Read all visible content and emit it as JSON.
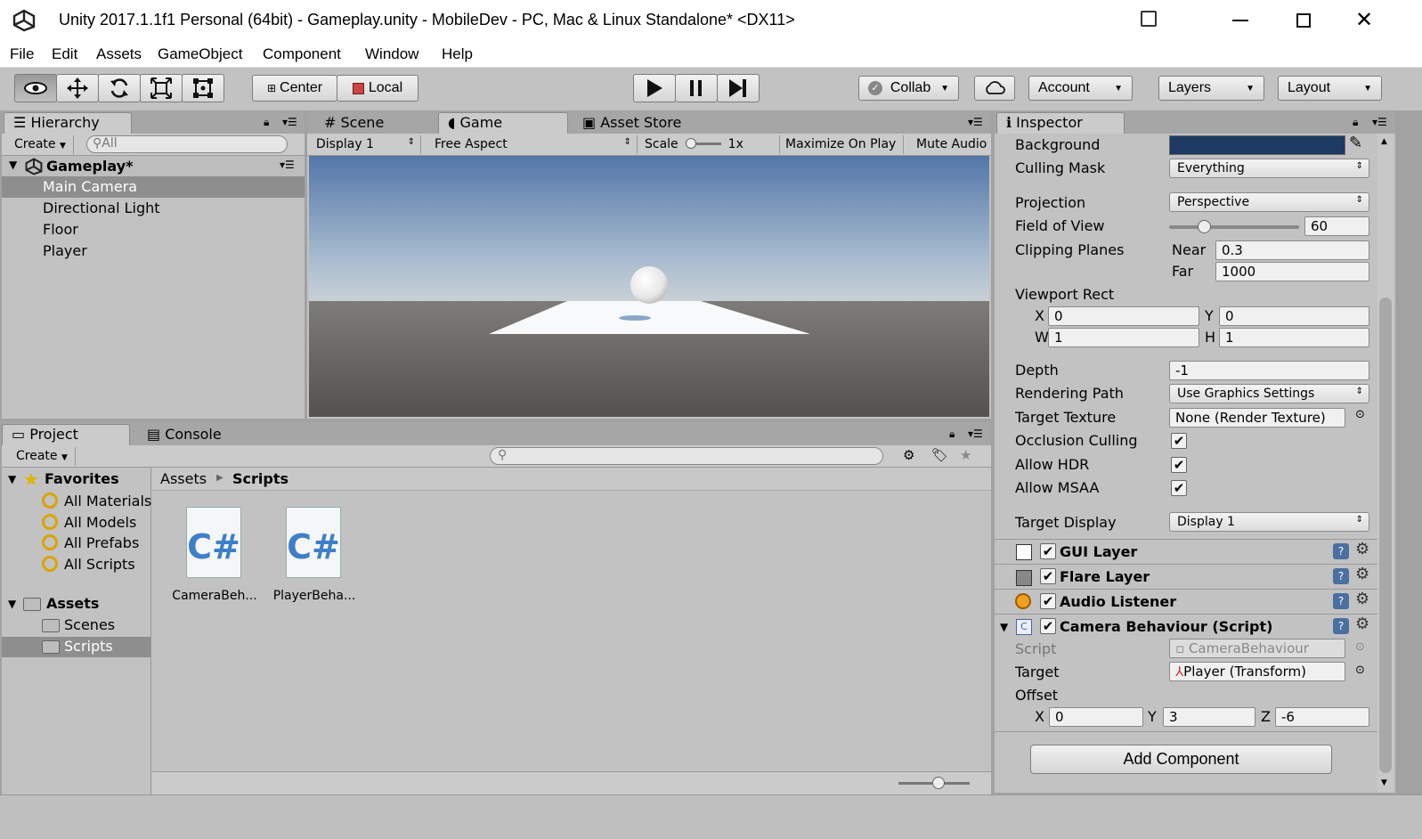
{
  "window": {
    "title": "Unity 2017.1.1f1 Personal (64bit) - Gameplay.unity - MobileDev - PC, Mac & Linux Standalone* <DX11>"
  },
  "menu": [
    "File",
    "Edit",
    "Assets",
    "GameObject",
    "Component",
    "Window",
    "Help"
  ],
  "toolbar": {
    "center": "Center",
    "local": "Local",
    "collab": "Collab",
    "account": "Account",
    "layers": "Layers",
    "layout": "Layout"
  },
  "hierarchy": {
    "tab": "Hierarchy",
    "create": "Create",
    "search_placeholder": "All",
    "scene": "Gameplay*",
    "items": [
      "Main Camera",
      "Directional Light",
      "Floor",
      "Player"
    ]
  },
  "views": {
    "scene_tab": "Scene",
    "game_tab": "Game",
    "store_tab": "Asset Store",
    "display": "Display 1",
    "aspect": "Free Aspect",
    "scale_label": "Scale",
    "scale_value": "1x",
    "maximize": "Maximize On Play",
    "mute": "Mute Audio"
  },
  "project": {
    "tab": "Project",
    "console_tab": "Console",
    "create": "Create",
    "favorites": "Favorites",
    "fav_items": [
      "All Materials",
      "All Models",
      "All Prefabs",
      "All Scripts"
    ],
    "assets": "Assets",
    "asset_folders": [
      "Scenes",
      "Scripts"
    ],
    "breadcrumb_root": "Assets",
    "breadcrumb_current": "Scripts",
    "files": [
      "CameraBeh...",
      "PlayerBeha..."
    ],
    "file_icon": "C#"
  },
  "inspector": {
    "tab": "Inspector",
    "background_color": "#1d3a63",
    "rows": {
      "background": "Background",
      "culling_mask": "Culling Mask",
      "culling_value": "Everything",
      "projection": "Projection",
      "projection_value": "Perspective",
      "fov": "Field of View",
      "fov_value": "60",
      "fov_level": 0.27,
      "clipping": "Clipping Planes",
      "near": "Near",
      "near_value": "0.3",
      "far": "Far",
      "far_value": "1000",
      "viewport": "Viewport Rect",
      "x": "X",
      "x_value": "0",
      "y": "Y",
      "y_value": "0",
      "w": "W",
      "w_value": "1",
      "h": "H",
      "h_value": "1",
      "depth": "Depth",
      "depth_value": "-1",
      "rendering_path": "Rendering Path",
      "rendering_value": "Use Graphics Settings",
      "target_texture": "Target Texture",
      "target_texture_value": "None (Render Texture)",
      "occlusion": "Occlusion Culling",
      "hdr": "Allow HDR",
      "msaa": "Allow MSAA",
      "target_display": "Target Display",
      "target_display_value": "Display 1"
    },
    "components": {
      "gui": "GUI Layer",
      "flare": "Flare Layer",
      "audio": "Audio Listener",
      "camera_behaviour": "Camera Behaviour (Script)"
    },
    "script": {
      "script_label": "Script",
      "script_value": "CameraBehaviour",
      "target_label": "Target",
      "target_value": "Player (Transform)",
      "offset_label": "Offset",
      "ox": "X",
      "ox_value": "0",
      "oy": "Y",
      "oy_value": "3",
      "oz": "Z",
      "oz_value": "-6"
    },
    "add_component": "Add Component"
  },
  "check_mark": "✔"
}
